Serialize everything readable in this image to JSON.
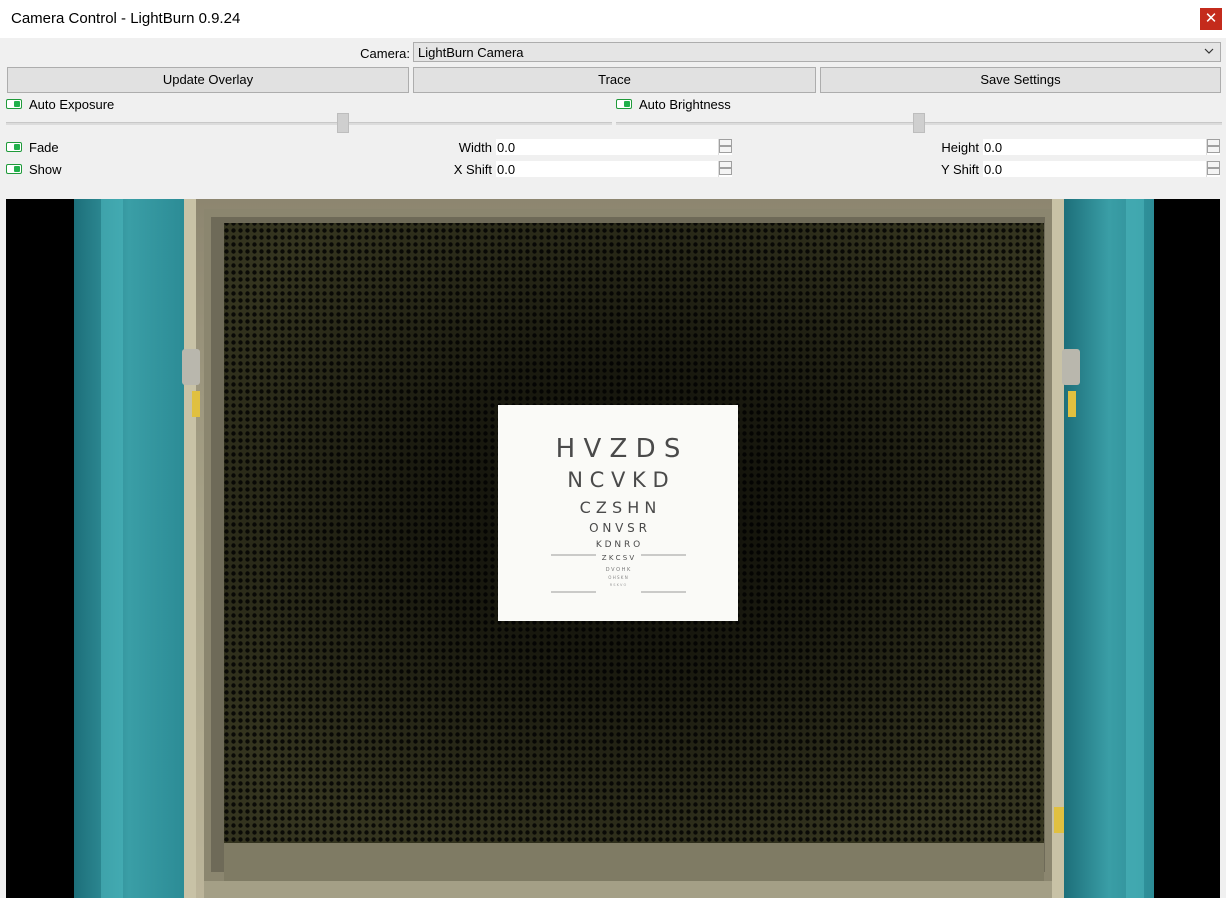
{
  "window": {
    "title": "Camera Control - LightBurn 0.9.24",
    "close_glyph": "✕"
  },
  "camera": {
    "label": "Camera:",
    "selected": "LightBurn Camera"
  },
  "buttons": {
    "update_overlay": "Update Overlay",
    "trace": "Trace",
    "save_settings": "Save Settings"
  },
  "auto": {
    "exposure_label": "Auto Exposure",
    "brightness_label": "Auto Brightness",
    "exposure_on": true,
    "brightness_on": true
  },
  "fade": {
    "label": "Fade",
    "on": true
  },
  "show": {
    "label": "Show",
    "on": true
  },
  "width": {
    "label": "Width",
    "value": "0.0"
  },
  "height": {
    "label": "Height",
    "value": "0.0"
  },
  "xshift": {
    "label": "X Shift",
    "value": "0.0"
  },
  "yshift": {
    "label": "Y Shift",
    "value": "0.0"
  },
  "chart": {
    "rows": [
      "H V Z D S",
      "N C V K D",
      "C Z S H N",
      "O N V S R",
      "K D N R O",
      "Z K C S V",
      "D V O H K",
      "O H S K N",
      "R S K V O"
    ]
  },
  "colors": {
    "toggle": "#22b14c",
    "close": "#c42b1c",
    "door": "#2c8c96"
  }
}
